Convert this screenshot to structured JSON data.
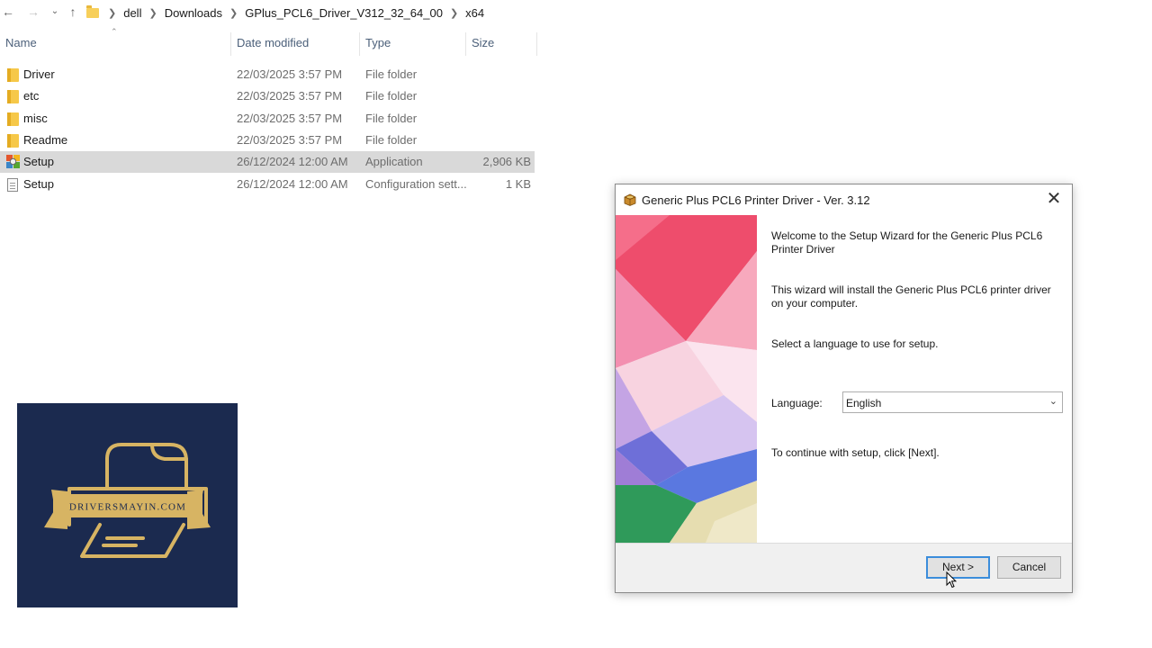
{
  "explorer": {
    "breadcrumb": [
      "dell",
      "Downloads",
      "GPlus_PCL6_Driver_V312_32_64_00",
      "x64"
    ],
    "columns": {
      "name": "Name",
      "date": "Date modified",
      "type": "Type",
      "size": "Size"
    },
    "rows": [
      {
        "name": "Driver",
        "date": "22/03/2025 3:57 PM",
        "type": "File folder",
        "size": "",
        "icon": "folder-icon"
      },
      {
        "name": "etc",
        "date": "22/03/2025 3:57 PM",
        "type": "File folder",
        "size": "",
        "icon": "folder-icon"
      },
      {
        "name": "misc",
        "date": "22/03/2025 3:57 PM",
        "type": "File folder",
        "size": "",
        "icon": "folder-icon"
      },
      {
        "name": "Readme",
        "date": "22/03/2025 3:57 PM",
        "type": "File folder",
        "size": "",
        "icon": "folder-icon"
      },
      {
        "name": "Setup",
        "date": "26/12/2024 12:00 AM",
        "type": "Application",
        "size": "2,906 KB",
        "icon": "setup-app-icon",
        "selected": true
      },
      {
        "name": "Setup",
        "date": "26/12/2024 12:00 AM",
        "type": "Configuration sett...",
        "size": "1 KB",
        "icon": "config-file-icon"
      }
    ]
  },
  "logo": {
    "text": "DRIVERSMAYIN.COM"
  },
  "dialog": {
    "title": "Generic Plus PCL6 Printer Driver - Ver. 3.12",
    "welcome": "Welcome to the Setup Wizard for the Generic Plus PCL6 Printer Driver",
    "intro": "This wizard will install the Generic Plus PCL6 printer driver on your computer.",
    "select_prompt": "Select a language to use for setup.",
    "language_label": "Language:",
    "language_value": "English",
    "continue_text": "To continue with setup, click [Next].",
    "next_label": "Next >",
    "cancel_label": "Cancel"
  },
  "colors": {
    "selection": "#d9d9d9",
    "logo_bg": "#1b2a4f",
    "logo_gold": "#d7b463",
    "focus_border": "#3b8ddb"
  }
}
